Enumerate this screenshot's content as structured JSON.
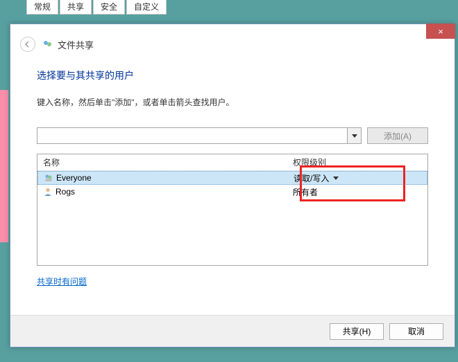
{
  "background_tabs": [
    "常规",
    "共享",
    "安全",
    "自定义"
  ],
  "window": {
    "title": "文件共享",
    "close_icon": "×"
  },
  "heading": "选择要与其共享的用户",
  "instruction": "键入名称，然后单击\"添加\"，或者单击箭头查找用户。",
  "combo": {
    "value": "",
    "placeholder": ""
  },
  "add_button": "添加(A)",
  "columns": {
    "name": "名称",
    "permission": "权限级别"
  },
  "rows": [
    {
      "name": "Everyone",
      "permission": "读取/写入",
      "selected": true,
      "dropdown": true,
      "icon": "group"
    },
    {
      "name": "Rogs",
      "permission": "所有者",
      "selected": false,
      "dropdown": false,
      "icon": "user"
    }
  ],
  "help_link": "共享时有问题",
  "footer": {
    "share": "共享(H)",
    "cancel": "取消"
  }
}
